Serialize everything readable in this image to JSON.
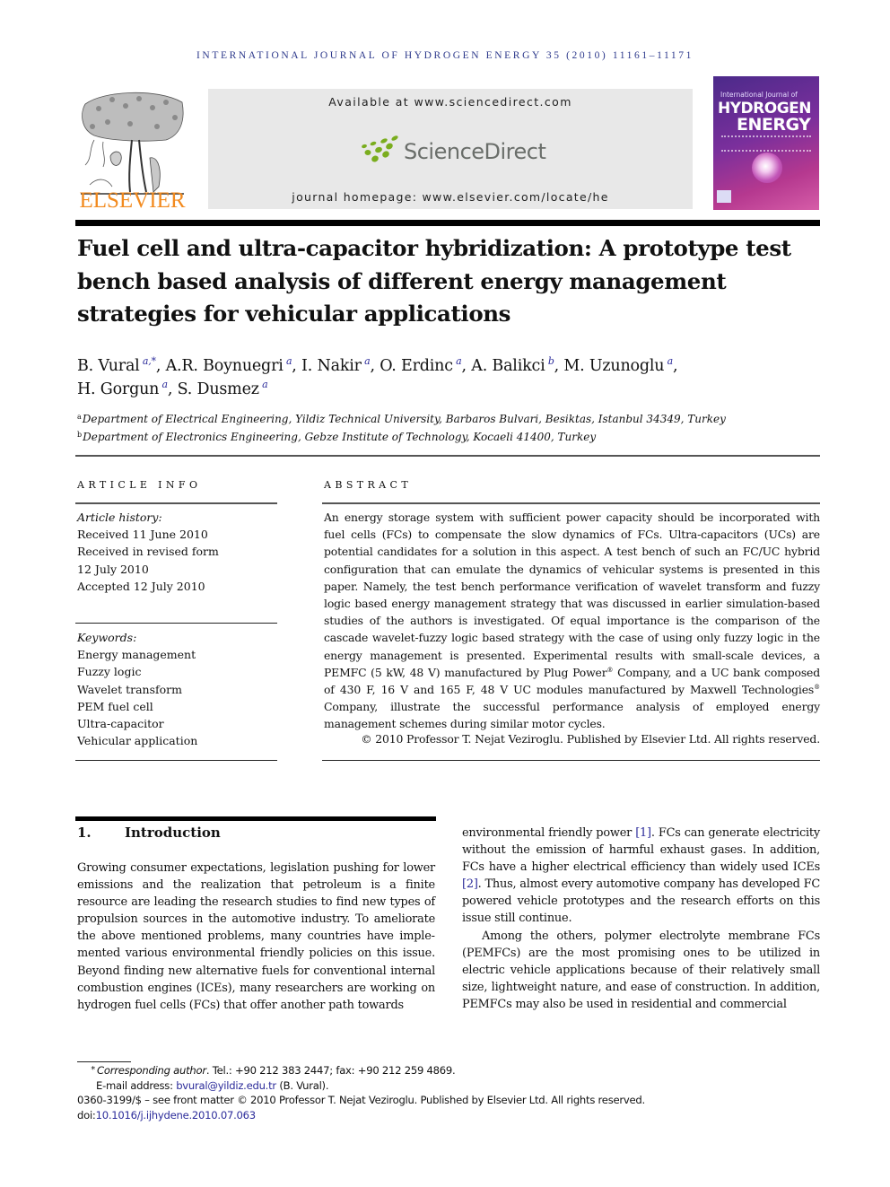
{
  "running_head": "INTERNATIONAL JOURNAL OF HYDROGEN ENERGY 35 (2010) 11161–11171",
  "header": {
    "publisher_logo_text": "ELSEVIER",
    "available_at": "Available at www.sciencedirect.com",
    "sciencedirect_logo_text": "ScienceDirect",
    "journal_homepage": "journal homepage: www.elsevier.com/locate/he",
    "cover": {
      "line1": "International Journal of",
      "line2": "HYDROGEN",
      "line3": "ENERGY"
    },
    "colors": {
      "running_head": "#2e3a8c",
      "elsevier_orange": "#f28a1e",
      "sciencedirect_green": "#7aad1e",
      "sciencedirect_gray": "#6a6e6a",
      "banner_bg": "#e8e8e8",
      "link_blue": "#2b2b9a"
    }
  },
  "article": {
    "title": "Fuel cell and ultra-capacitor hybridization: A prototype test bench based analysis of different energy management strategies for vehicular applications",
    "authors": [
      {
        "name": "B. Vural",
        "aff": "a,*"
      },
      {
        "name": "A.R. Boynuegri",
        "aff": "a"
      },
      {
        "name": "I. Nakir",
        "aff": "a"
      },
      {
        "name": "O. Erdinc",
        "aff": "a"
      },
      {
        "name": "A. Balikci",
        "aff": "b"
      },
      {
        "name": "M. Uzunoglu",
        "aff": "a"
      },
      {
        "name": "H. Gorgun",
        "aff": "a"
      },
      {
        "name": "S. Dusmez",
        "aff": "a"
      }
    ],
    "affiliations": [
      {
        "mark": "a",
        "text": "Department of Electrical Engineering, Yildiz Technical University, Barbaros Bulvari, Besiktas, Istanbul 34349, Turkey"
      },
      {
        "mark": "b",
        "text": "Department of Electronics Engineering, Gebze Institute of Technology, Kocaeli 41400, Turkey"
      }
    ]
  },
  "article_info": {
    "heading": "ARTICLE INFO",
    "history_label": "Article history:",
    "history": [
      "Received 11 June 2010",
      "Received in revised form",
      "12 July 2010",
      "Accepted 12 July 2010"
    ],
    "keywords_label": "Keywords:",
    "keywords": [
      "Energy management",
      "Fuzzy logic",
      "Wavelet transform",
      "PEM fuel cell",
      "Ultra-capacitor",
      "Vehicular application"
    ]
  },
  "abstract": {
    "heading": "ABSTRACT",
    "text_part1": "An energy storage system with sufficient power capacity should be incorporated with fuel cells (FCs) to compensate the slow dynamics of FCs. Ultra-capacitors (UCs) are potential candidates for a solution in this aspect. A test bench of such an FC/UC hybrid configuration that can emulate the dynamics of vehicular systems is presented in this paper. Namely, the test bench performance verification of wavelet transform and fuzzy logic based energy management strategy that was discussed in earlier simulation-based studies of the authors is investigated. Of equal importance is the comparison of the cascade wavelet-fuzzy logic based strategy with the case of using only fuzzy logic in the energy manage­ment is presented. Experimental results with small-scale devices, a PEMFC (5 kW, 48 V) manufactured by Plug Power",
    "reg_mark": "®",
    "text_part2": " Company, and a UC bank composed of 430 F, 16 V and 165 F, 48 V UC modules manufactured by Maxwell Technologies",
    "text_part3": " Company, illustrate the successful performance analysis of employed energy management schemes during similar motor cycles.",
    "copyright": "© 2010 Professor T. Nejat Veziroglu. Published by Elsevier Ltd. All rights reserved."
  },
  "introduction": {
    "number": "1.",
    "heading": "Introduction",
    "left_text": "Growing consumer expectations, legislation pushing for lower emissions and the realization that petroleum is a finite resource are leading the research studies to find new types of propulsion sources in the automotive industry. To ameliorate the above mentioned problems, many countries have imple­mented various environmental friendly policies on this issue. Beyond finding new alternative fuels for conventional internal combustion engines (ICEs), many researchers are working on hydrogen fuel cells (FCs) that offer another path towards",
    "right_p1_a": "environmental friendly power ",
    "ref1": "[1]",
    "right_p1_b": ". FCs can generate electricity without the emission of harmful exhaust gases. In addition, FCs have a higher electrical efficiency than widely used ICEs ",
    "ref2": "[2]",
    "right_p1_c": ". Thus, almost every automotive company has developed FC powered vehicle prototypes and the research efforts on this issue still continue.",
    "right_p2": "Among the others, polymer electrolyte membrane FCs (PEMFCs) are the most promising ones to be utilized in electric vehicle applications because of their relatively small size, lightweight nature, and ease of construction. In addition, PEMFCs may also be used in residential and commercial"
  },
  "footnotes": {
    "star": "*",
    "corresponding_label": "Corresponding author",
    "corresponding_rest": ". Tel.: +90 212 383 2447; fax: +90 212 259 4869.",
    "email_label": "E-mail address: ",
    "email": "bvural@yildiz.edu.tr",
    "email_rest": " (B. Vural).",
    "front_matter": "0360-3199/$ – see front matter © 2010 Professor T. Nejat Veziroglu. Published by Elsevier Ltd. All rights reserved.",
    "doi_label": "doi:",
    "doi": "10.1016/j.ijhydene.2010.07.063"
  }
}
